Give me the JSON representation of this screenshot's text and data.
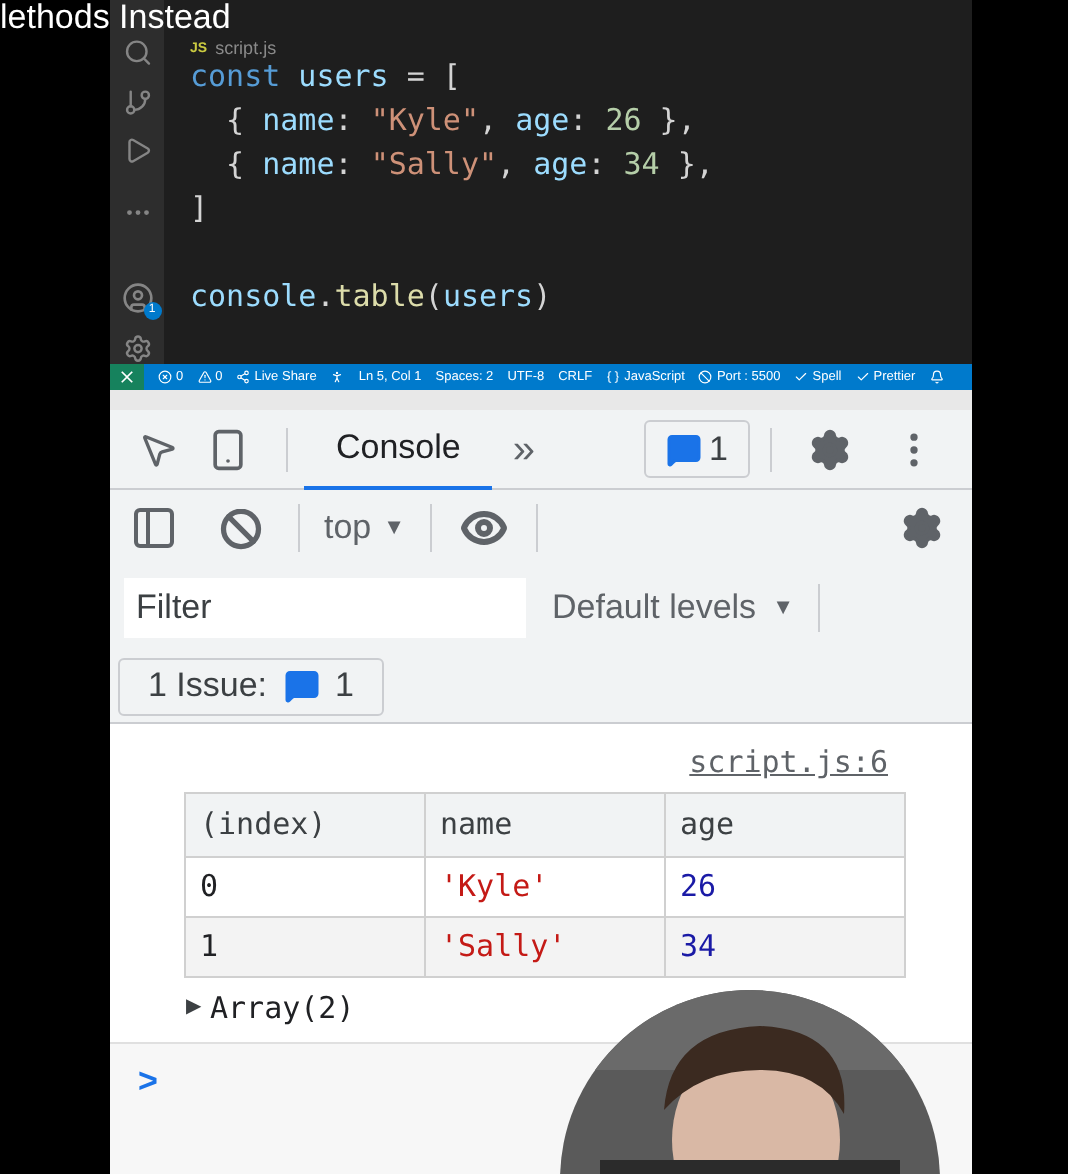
{
  "caption": "lethods Instead",
  "editor": {
    "file_tab": {
      "badge": "JS",
      "name": "script.js"
    },
    "account_badge": "1",
    "lines": [
      {
        "kind": "code",
        "tokens": [
          {
            "text": "const",
            "kind": "keyword"
          },
          {
            "text": " users",
            "kind": "var"
          },
          {
            "text": " = [",
            "kind": "punct"
          }
        ]
      },
      {
        "kind": "code",
        "tokens": [
          {
            "text": "  { ",
            "kind": "punct"
          },
          {
            "text": "name",
            "kind": "var"
          },
          {
            "text": ": ",
            "kind": "punct"
          },
          {
            "text": "\"Kyle\"",
            "kind": "string"
          },
          {
            "text": ", ",
            "kind": "punct"
          },
          {
            "text": "age",
            "kind": "var"
          },
          {
            "text": ": ",
            "kind": "punct"
          },
          {
            "text": "26",
            "kind": "number"
          },
          {
            "text": " },",
            "kind": "punct"
          }
        ]
      },
      {
        "kind": "code",
        "tokens": [
          {
            "text": "  { ",
            "kind": "punct"
          },
          {
            "text": "name",
            "kind": "var"
          },
          {
            "text": ": ",
            "kind": "punct"
          },
          {
            "text": "\"Sally\"",
            "kind": "string"
          },
          {
            "text": ", ",
            "kind": "punct"
          },
          {
            "text": "age",
            "kind": "var"
          },
          {
            "text": ": ",
            "kind": "punct"
          },
          {
            "text": "34",
            "kind": "number"
          },
          {
            "text": " },",
            "kind": "punct"
          }
        ]
      },
      {
        "kind": "code",
        "tokens": [
          {
            "text": "]",
            "kind": "punct"
          }
        ]
      },
      {
        "kind": "blank"
      },
      {
        "kind": "code",
        "tokens": [
          {
            "text": "console",
            "kind": "var"
          },
          {
            "text": ".",
            "kind": "punct"
          },
          {
            "text": "table",
            "kind": "func"
          },
          {
            "text": "(",
            "kind": "punct"
          },
          {
            "text": "users",
            "kind": "var"
          },
          {
            "text": ")",
            "kind": "punct"
          }
        ]
      }
    ]
  },
  "status_bar": [
    "0",
    "0",
    "Live Share",
    "Ln 5, Col 1",
    "Spaces: 2",
    "UTF-8",
    "CRLF",
    "JavaScript",
    "Port : 5500",
    "Spell",
    "Prettier"
  ],
  "devtools": {
    "tabs": [
      {
        "label": "Console",
        "selected": true
      }
    ],
    "more": "»",
    "issues_count": "1",
    "context": "top",
    "context_arrow": "▼",
    "levels_arrow": "▼",
    "expand_arrow": "▶",
    "filter": {
      "placeholder": "Filter"
    },
    "levels": "Default levels",
    "issues_button": {
      "label": "1 Issue:",
      "count": "1"
    },
    "source_link": "script.js:6",
    "table": {
      "columns": [
        "(index)",
        "name",
        "age"
      ],
      "rows": [
        [
          {
            "text": "0",
            "kind": "index"
          },
          {
            "text": "'Kyle'",
            "kind": "string"
          },
          {
            "text": "26",
            "kind": "number"
          }
        ],
        [
          {
            "text": "1",
            "kind": "index"
          },
          {
            "text": "'Sally'",
            "kind": "string"
          },
          {
            "text": "34",
            "kind": "number"
          }
        ]
      ]
    },
    "array_label": "Array(2)",
    "prompt": ">"
  }
}
